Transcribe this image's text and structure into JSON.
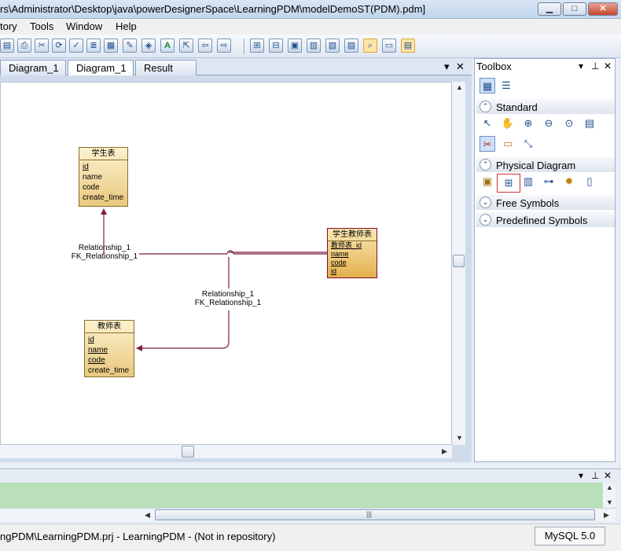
{
  "window": {
    "title": "rs\\Administrator\\Desktop\\java\\powerDesignerSpace\\LearningPDM\\modelDemoST(PDM).pdm]",
    "minimize": "▁",
    "maximize": "□",
    "close": "✕"
  },
  "menu": {
    "items": [
      "tory",
      "Tools",
      "Window",
      "Help"
    ]
  },
  "toolbar": {
    "icons": [
      "save-icon",
      "print-icon",
      "cut-icon",
      "refresh-icon",
      "check-icon",
      "list-icon",
      "grid-icon",
      "pen-icon",
      "paint-icon",
      "text-icon",
      "export-icon",
      "undo-icon",
      "redo-icon",
      "layout1-icon",
      "layout2-icon",
      "layout3-icon",
      "layout4-icon",
      "layout5-icon",
      "layout6-icon",
      "zoom-view-icon",
      "window1-icon",
      "window2-icon"
    ]
  },
  "tabs": {
    "items": [
      "Diagram_1",
      "Diagram_1",
      "Result List"
    ],
    "pin": "▾",
    "close": "✕"
  },
  "diagram": {
    "entities": [
      {
        "name": "学生表",
        "columns": [
          "id",
          "name",
          "code",
          "create_time"
        ],
        "pk": [
          true,
          false,
          false,
          false
        ]
      },
      {
        "name": "学生教师表",
        "columns": [
          "教师表_id",
          "name",
          "code",
          "id"
        ],
        "pk": [
          true,
          true,
          true,
          true
        ]
      },
      {
        "name": "教师表",
        "columns": [
          "id",
          "name",
          "code",
          "create_time"
        ],
        "pk": [
          true,
          true,
          true,
          false
        ]
      }
    ],
    "relationships": [
      {
        "name": "Relationship_1",
        "fk": "FK_Relationship_1"
      },
      {
        "name": "Relationship_1",
        "fk": "FK_Relationship_1"
      }
    ]
  },
  "toolbox": {
    "title": "Toolbox",
    "pin": "▾",
    "pushpin": "⊥",
    "close": "✕",
    "sections": {
      "standard": "Standard",
      "physical": "Physical Diagram",
      "free": "Free Symbols",
      "predefined": "Predefined Symbols"
    }
  },
  "output": {
    "pin": "▾",
    "pushpin": "⊥",
    "close": "✕",
    "scroll_grip": "|||"
  },
  "status": {
    "text": "ngPDM\\LearningPDM.prj - LearningPDM - (Not in repository)",
    "dbms": "MySQL 5.0"
  },
  "colors": {
    "relationship_line": "#7b1a45",
    "entity_fill": "#f2d793",
    "output_bg": "#b9e0b8"
  }
}
